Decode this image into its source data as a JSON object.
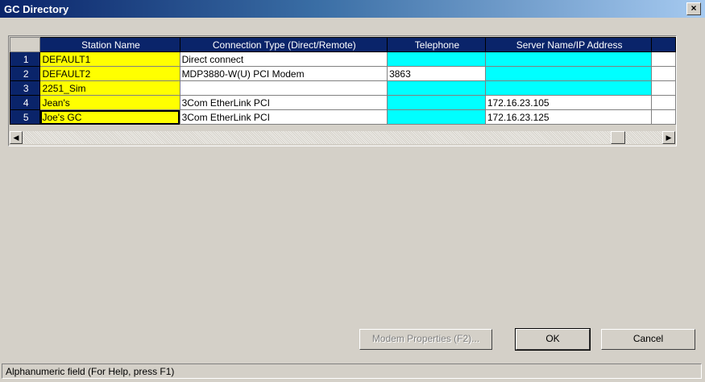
{
  "window": {
    "title": "GC Directory",
    "close_label": "×"
  },
  "grid": {
    "columns": [
      "Station Name",
      "Connection Type (Direct/Remote)",
      "Telephone",
      "Server Name/IP Address"
    ],
    "rows": [
      {
        "num": "1",
        "station": "DEFAULT1",
        "connection": "Direct connect",
        "telephone": "",
        "server": ""
      },
      {
        "num": "2",
        "station": "DEFAULT2",
        "connection": "MDP3880-W(U) PCI Modem",
        "telephone": "3863",
        "server": ""
      },
      {
        "num": "3",
        "station": "2251_Sim",
        "connection": "",
        "telephone": "",
        "server": ""
      },
      {
        "num": "4",
        "station": "Jean's",
        "connection": "3Com EtherLink PCI",
        "telephone": "",
        "server": "172.16.23.105"
      },
      {
        "num": "5",
        "station": "Joe's GC",
        "connection": "3Com EtherLink PCI",
        "telephone": "",
        "server": "172.16.23.125"
      }
    ],
    "scroll_left_icon": "left-arrow-icon",
    "scroll_right_icon": "right-arrow-icon"
  },
  "buttons": {
    "modem_properties": "Modem Properties (F2)...",
    "ok": "OK",
    "cancel": "Cancel"
  },
  "status": {
    "text": "Alphanumeric field (For Help, press F1)"
  },
  "colors": {
    "station_name_bg": "#ffff00",
    "highlight_bg": "#00ffff",
    "header_bg": "#0a246a"
  }
}
